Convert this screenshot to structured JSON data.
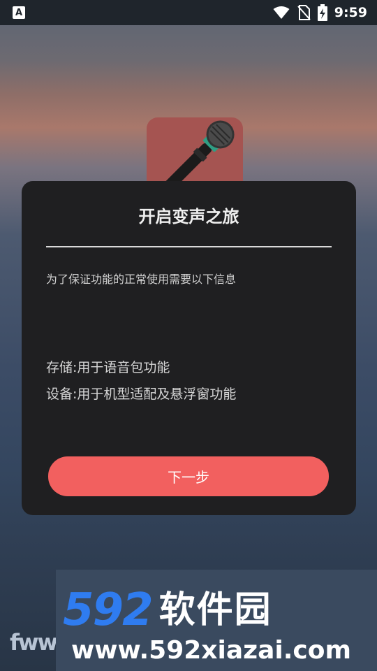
{
  "status_bar": {
    "time": "9:59",
    "left_icon_label": "A",
    "icons": [
      "app-notification-icon",
      "wifi-icon",
      "no-sim-icon",
      "battery-charging-icon"
    ]
  },
  "dialog": {
    "title": "开启变声之旅",
    "intro": "为了保证功能的正常使用需要以下信息",
    "permissions": [
      "存储:用于语音包功能",
      "设备:用于机型适配及悬浮窗功能"
    ],
    "next_button": "下一步"
  },
  "watermark": {
    "brand_num": "592",
    "brand_cn": "软件园",
    "url": "www.592xiazai.com",
    "left_fragment": "fww"
  },
  "colors": {
    "button": "#f2605f",
    "dialog_bg": "#1f1f21",
    "icon_bg": "#a55451",
    "brand_blue": "#2f7cf0"
  }
}
